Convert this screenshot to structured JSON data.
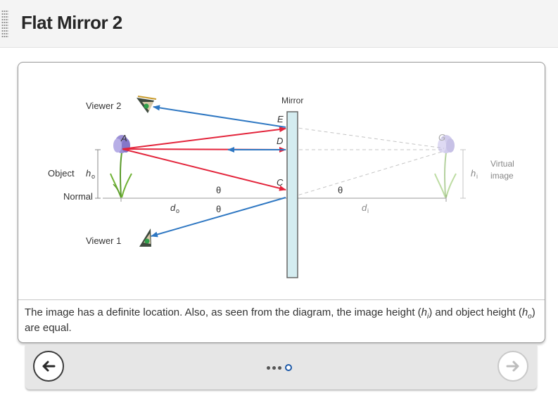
{
  "page": {
    "title": "Flat Mirror 2"
  },
  "diagram": {
    "labels": {
      "mirror": "Mirror",
      "viewer2": "Viewer 2",
      "viewer1": "Viewer 1",
      "object": "Object",
      "normal": "Normal",
      "virtual_line1": "Virtual",
      "virtual_line2": "image",
      "point_a": "A",
      "point_e": "E",
      "point_d": "D",
      "point_c": "C",
      "point_g": "G",
      "h_o": "h",
      "h_o_sub": "o",
      "h_i": "h",
      "h_i_sub": "i",
      "d_o": "d",
      "d_o_sub": "o",
      "d_i": "d",
      "d_i_sub": "i",
      "theta": "θ"
    },
    "colors": {
      "red_ray": "#e3243b",
      "blue_ray": "#2e77c2",
      "mirror_fill": "#d4ecf0",
      "virtual": "#bdbdbd"
    }
  },
  "caption": {
    "part1": "The image has a definite location. Also, as seen from the diagram, the image height (",
    "hi": "h",
    "hi_sub": "i",
    "part2": ") and object height (",
    "ho": "h",
    "ho_sub": "o",
    "part3": ") are equal."
  },
  "navigation": {
    "prev_icon": "arrow-left-icon",
    "next_icon": "arrow-right-icon",
    "current_page": 4,
    "total_pages": 4
  }
}
